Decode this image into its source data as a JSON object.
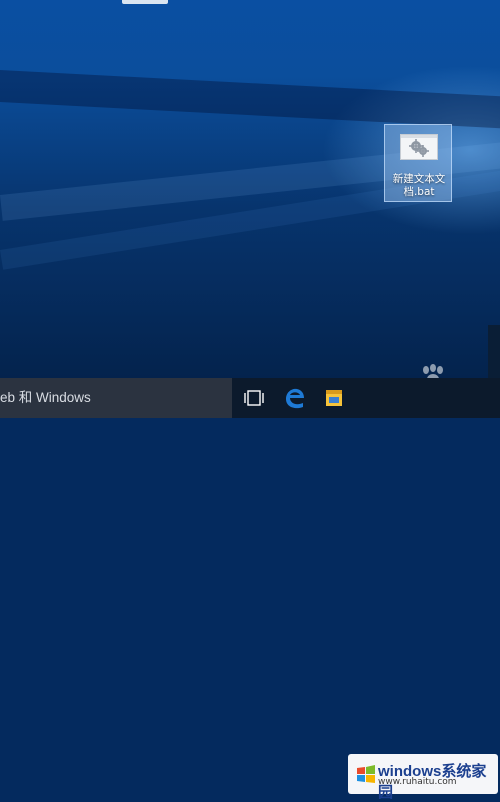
{
  "desktop": {
    "icon": {
      "label": "新建文本文档.bat",
      "icon_name": "batch-file-gear-icon"
    }
  },
  "taskbar": {
    "search_text": "eb 和 Windows",
    "buttons": [
      {
        "name": "task-view-icon"
      },
      {
        "name": "edge-icon"
      },
      {
        "name": "file-explorer-icon"
      }
    ]
  },
  "watermark": {
    "brand": "windows系统家园",
    "url": "www.ruhaitu.com"
  },
  "colors": {
    "desktop_blue": "#0a4fa2",
    "taskbar": "#0c1a2c",
    "edge_blue": "#1e7ad6",
    "explorer_yellow": "#f6c33a"
  }
}
